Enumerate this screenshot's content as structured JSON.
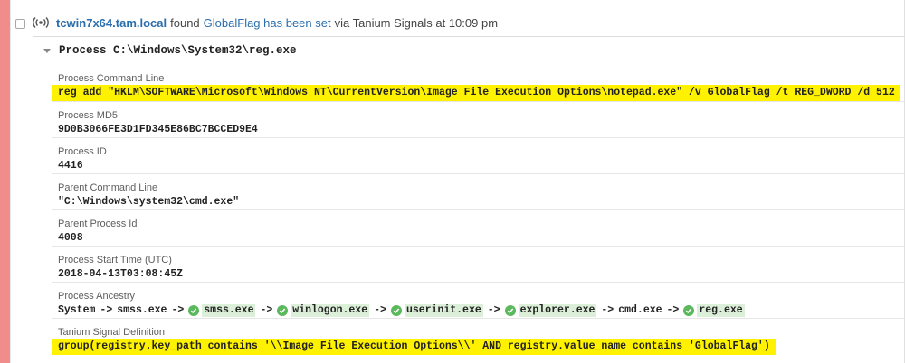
{
  "event": {
    "host": "tcwin7x64.tam.local",
    "found_text": "found",
    "signal_name": "GlobalFlag has been set",
    "via_text": "via Tanium Signals at 10:09 pm"
  },
  "process": {
    "title": "Process C:\\Windows\\System32\\reg.exe"
  },
  "fields": [
    {
      "label": "Process Command Line",
      "value": "reg add \"HKLM\\SOFTWARE\\Microsoft\\Windows NT\\CurrentVersion\\Image File Execution Options\\notepad.exe\" /v GlobalFlag /t REG_DWORD /d 512"
    },
    {
      "label": "Process MD5",
      "value": "9D0B3066FE3D1FD345E86BC7BCCED9E4"
    },
    {
      "label": "Process ID",
      "value": "4416"
    },
    {
      "label": "Parent Command Line",
      "value": "\"C:\\Windows\\system32\\cmd.exe\""
    },
    {
      "label": "Parent Process Id",
      "value": "4008"
    },
    {
      "label": "Process Start Time (UTC)",
      "value": "2018-04-13T03:08:45Z"
    },
    {
      "label": "Process Ancestry",
      "value": ""
    },
    {
      "label": "Tanium Signal Definition",
      "value": "group(registry.key_path contains '\\\\Image File Execution Options\\\\' AND registry.value_name contains 'GlobalFlag')"
    }
  ],
  "ancestry": {
    "arrow": "->",
    "items": [
      {
        "name": "System",
        "verified": false
      },
      {
        "name": "smss.exe",
        "verified": false
      },
      {
        "name": "smss.exe",
        "verified": true
      },
      {
        "name": "winlogon.exe",
        "verified": true
      },
      {
        "name": "userinit.exe",
        "verified": true
      },
      {
        "name": "explorer.exe",
        "verified": true
      },
      {
        "name": "cmd.exe",
        "verified": false
      },
      {
        "name": "reg.exe",
        "verified": true
      }
    ]
  },
  "colors": {
    "alert_stripe": "#f08c8c",
    "link": "#2a6ead",
    "highlight": "#fff200",
    "verified": "#5cb85c"
  },
  "icons": {
    "signal": "broadcast-signal-icon",
    "caret": "caret-down-icon",
    "verified": "check-circle-icon"
  }
}
